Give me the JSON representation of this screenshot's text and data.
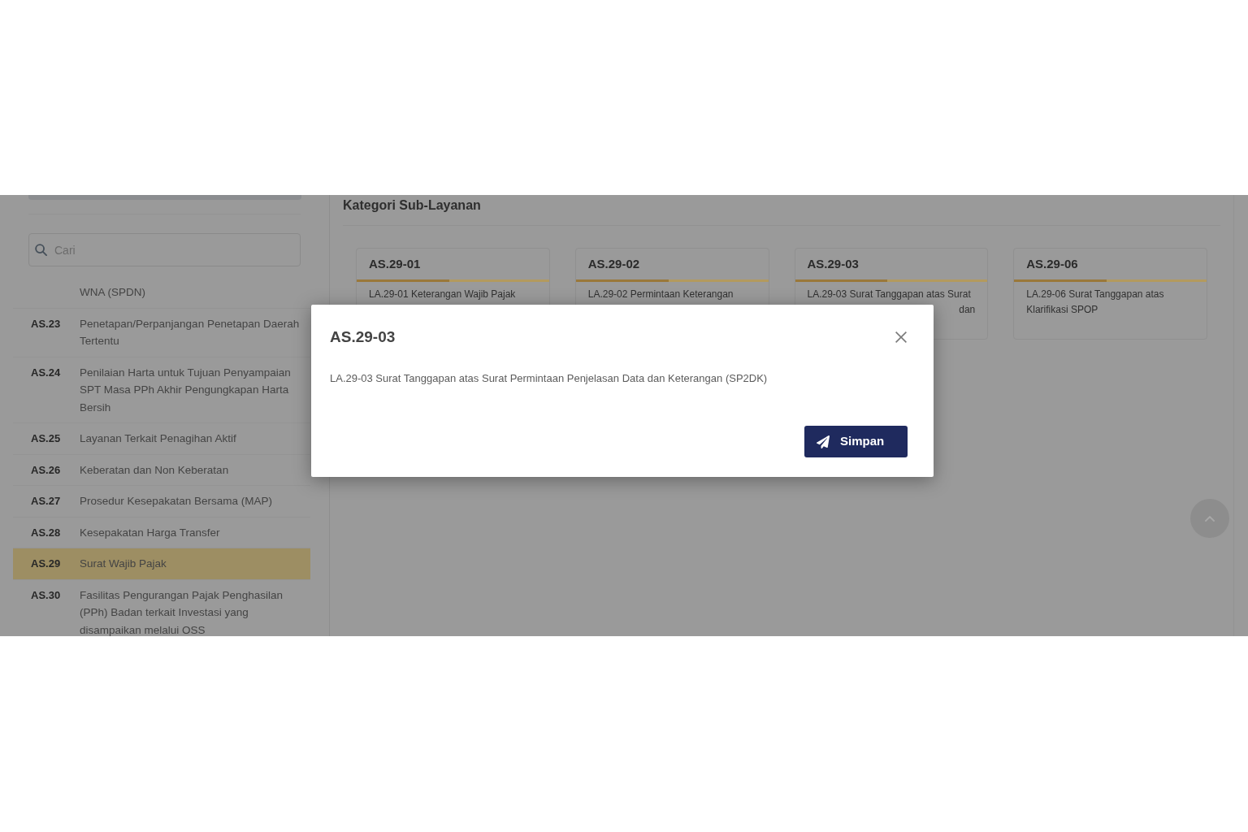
{
  "sidebar": {
    "search": {
      "placeholder": "Cari"
    },
    "items": [
      {
        "name": "WNA (SPDN)",
        "selected": false
      },
      {
        "code": "AS.23",
        "name": "Penetapan/Perpanjangan Penetapan Daerah Tertentu",
        "selected": false
      },
      {
        "code": "AS.24",
        "name": "Penilaian Harta untuk Tujuan Penyampaian SPT Masa PPh Akhir Pengungkapan Harta Bersih",
        "selected": false
      },
      {
        "code": "AS.25",
        "name": "Layanan Terkait Penagihan Aktif",
        "selected": false
      },
      {
        "code": "AS.26",
        "name": "Keberatan dan Non Keberatan",
        "selected": false
      },
      {
        "code": "AS.27",
        "name": "Prosedur Kesepakatan Bersama (MAP)",
        "selected": false
      },
      {
        "code": "AS.28",
        "name": "Kesepakatan Harga Transfer",
        "selected": false
      },
      {
        "code": "AS.29",
        "name": "Surat Wajib Pajak",
        "selected": true
      },
      {
        "code": "AS.30",
        "name": "Fasilitas Pengurangan Pajak Penghasilan (PPh) Badan terkait Investasi yang disampaikan melalui OSS",
        "selected": false
      }
    ]
  },
  "main": {
    "title": "Kategori Sub-Layanan",
    "cards": [
      {
        "code": "AS.29-01",
        "description": "LA.29-01 Keterangan Wajib Pajak"
      },
      {
        "code": "AS.29-02",
        "description": "LA.29-02 Permintaan Keterangan"
      },
      {
        "code": "AS.29-03",
        "description": "LA.29-03 Surat Tanggapan atas Surat",
        "covered_line_end": "dan"
      },
      {
        "code": "AS.29-06",
        "description": "LA.29-06 Surat Tanggapan atas Klarifikasi SPOP"
      }
    ]
  },
  "dialog": {
    "title": "AS.29-03",
    "message": "LA.29-03 Surat Tanggapan atas Surat Permintaan Penjelasan Data dan Keterangan (SP2DK)",
    "button": "Simpan"
  }
}
